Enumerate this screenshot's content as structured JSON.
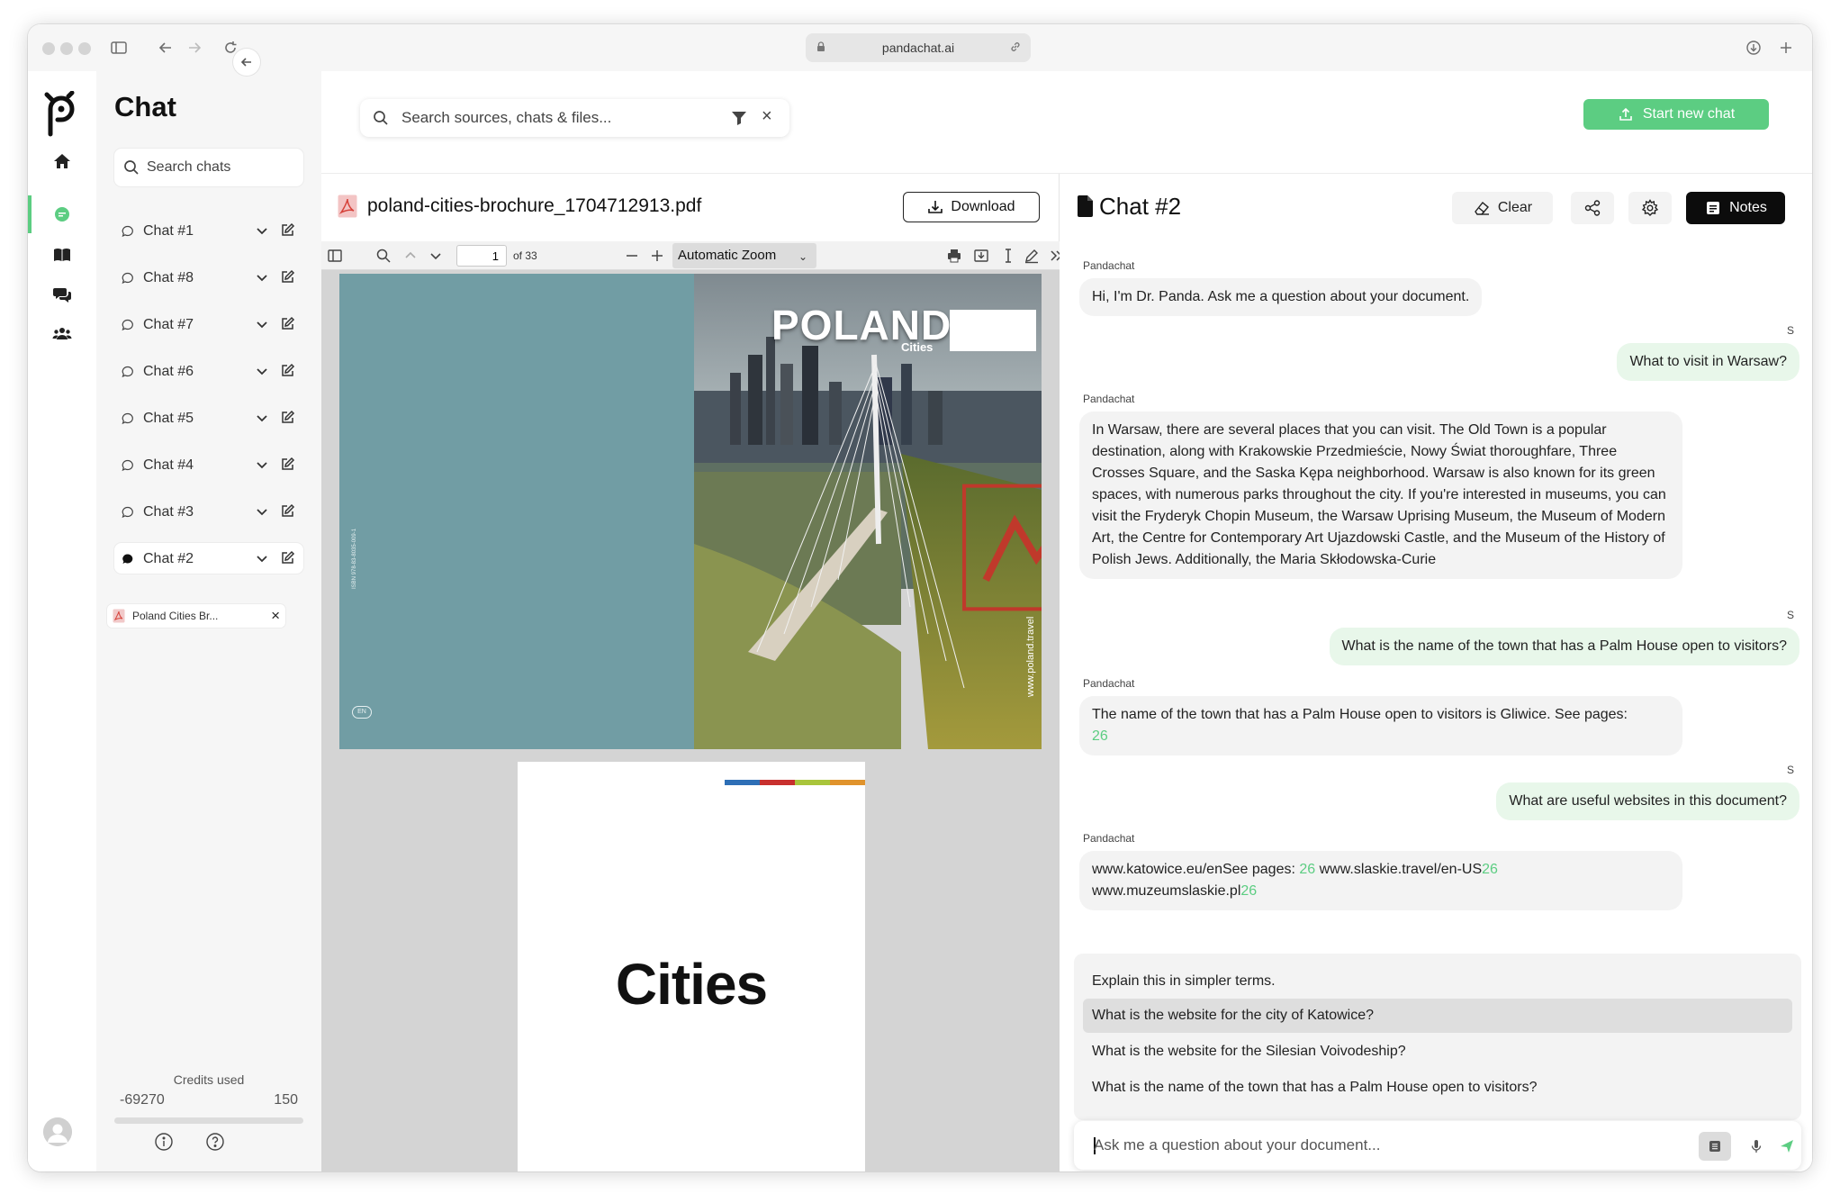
{
  "browser": {
    "url": "pandachat.ai"
  },
  "sidebar": {
    "title": "Chat",
    "search_placeholder": "Search chats",
    "chats": [
      {
        "label": "Chat #1",
        "active": false
      },
      {
        "label": "Chat #8",
        "active": false
      },
      {
        "label": "Chat #7",
        "active": false
      },
      {
        "label": "Chat #6",
        "active": false
      },
      {
        "label": "Chat #5",
        "active": false
      },
      {
        "label": "Chat #4",
        "active": false
      },
      {
        "label": "Chat #3",
        "active": false
      },
      {
        "label": "Chat #2",
        "active": true
      }
    ],
    "active_file": "Poland Cities Br...",
    "credits_label": "Credits used",
    "credits_used": "-69270",
    "credits_total": "150"
  },
  "topbar": {
    "search_placeholder": "Search sources, chats & files...",
    "new_chat_label": "Start new chat"
  },
  "pdf": {
    "filename": "poland-cities-brochure_1704712913.pdf",
    "download_label": "Download",
    "page_number": "1",
    "page_of": "of 33",
    "zoom": "Automatic Zoom",
    "cover_title": "POLAND",
    "cover_subtitle": "Cities",
    "cover_url": "www.poland.travel",
    "cover_isbn": "ISBN 978-83-8035-009-1",
    "cover_lang": "EN",
    "page2_title": "Cities"
  },
  "chat": {
    "title": "Chat #2",
    "clear_label": "Clear",
    "notes_label": "Notes",
    "ai_name": "Pandachat",
    "user_initial": "S",
    "messages": {
      "m1": "Hi, I'm Dr. Panda. Ask me a question about your document.",
      "m2": "What to visit in Warsaw?",
      "m3": "In Warsaw, there are several places that you can visit. The Old Town is a popular destination, along with Krakowskie Przedmieście, Nowy Świat thoroughfare, Three Crosses Square, and the Saska Kępa neighborhood. Warsaw is also known for its green spaces, with numerous parks throughout the city. If you're interested in museums, you can visit the Fryderyk Chopin Museum, the Warsaw Uprising Museum, the Museum of Modern Art, the Centre for Contemporary Art Ujazdowski Castle, and the Museum of the History of Polish Jews. Additionally, the Maria Skłodowska-Curie",
      "m4": "What is the name of the town that has a Palm House open to visitors?",
      "m5_text": "The name of the town that has a Palm House open to visitors is Gliwice. See pages:",
      "m5_ref": "26",
      "m6": "What are useful websites in this document?",
      "m7_a": "www.katowice.eu/enSee pages:",
      "m7_ref1": "26",
      "m7_b": "www.slaskie.travel/en-US",
      "m7_ref2": "26",
      "m7_c": "www.muzeumslaskie.pl",
      "m7_ref3": "26"
    },
    "suggestions": [
      "Explain this in simpler terms.",
      "What is the website for the city of Katowice?",
      "What is the website for the Silesian Voivodeship?",
      "What is the name of the town that has a Palm House open to visitors?"
    ],
    "input_placeholder": "Ask me a question about your document..."
  },
  "colors": {
    "accent": "#5ccd82",
    "user_bubble": "#e8f7ea",
    "ai_bubble": "#f3f3f3",
    "cover_teal": "#719da4"
  }
}
